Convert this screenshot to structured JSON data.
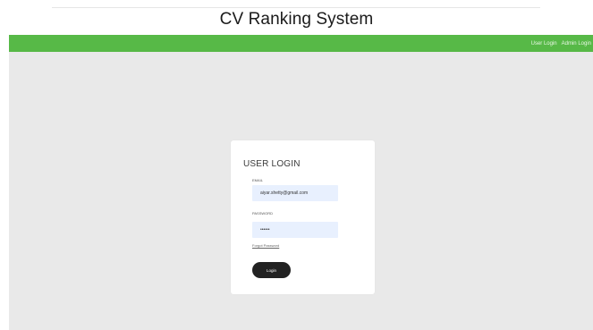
{
  "header": {
    "title": "CV Ranking System"
  },
  "nav": {
    "links": [
      "User Login",
      "Admin Login"
    ]
  },
  "login": {
    "title": "USER LOGIN",
    "email_label": "EMAIL",
    "email_value": "aiyar.shetty@gmail.com",
    "password_label": "PASSWORD",
    "password_value": "••••••",
    "forgot_label": "Forgot Password",
    "login_label": "Login"
  },
  "colors": {
    "navbar": "#57b947",
    "background": "#e9e9e9",
    "input": "#e8f0fe",
    "button": "#222222"
  }
}
